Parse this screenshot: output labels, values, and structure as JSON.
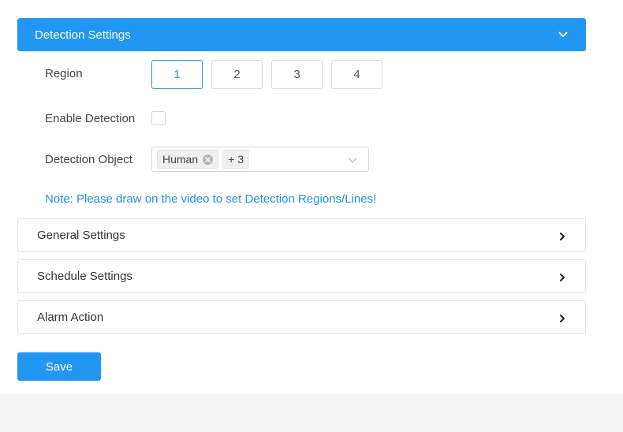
{
  "detection_panel": {
    "title": "Detection Settings",
    "region_label": "Region",
    "regions": [
      "1",
      "2",
      "3",
      "4"
    ],
    "selected_region": "1",
    "enable_label": "Enable Detection",
    "enable_checked": false,
    "object_label": "Detection Object",
    "object_tag": "Human",
    "object_more": "+ 3",
    "note": "Note: Please draw on the video to set Detection Regions/Lines!"
  },
  "sections": [
    {
      "title": "General Settings"
    },
    {
      "title": "Schedule Settings"
    },
    {
      "title": "Alarm Action"
    }
  ],
  "save_label": "Save",
  "colors": {
    "accent": "#2196f3",
    "note": "#1e90f0",
    "background_band": "#f5f5f5"
  },
  "icons": {
    "header_chevron": "chevron-down-icon",
    "section_chevron": "chevron-right-icon",
    "tag_close": "close-circle-icon",
    "dropdown_arrow": "chevron-down-icon"
  }
}
